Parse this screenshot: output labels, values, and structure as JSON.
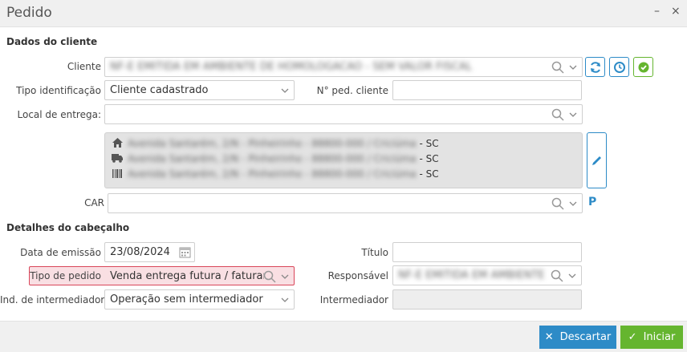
{
  "window": {
    "title": "Pedido",
    "minimize_glyph": "–",
    "close_glyph": "×"
  },
  "sections": {
    "client": "Dados do cliente",
    "header": "Detalhes do cabeçalho"
  },
  "client": {
    "cliente_label": "Cliente",
    "cliente_value": "NF-E EMITIDA EM AMBIENTE DE HOMOLOGACAO - SEM VALOR FISCAL",
    "tipo_label": "Tipo identificação",
    "tipo_value": "Cliente cadastrado",
    "nped_label": "N° ped. cliente",
    "nped_value": "",
    "local_label": "Local de entrega:",
    "local_value": "",
    "addresses": [
      {
        "icon": "home-icon",
        "blurred": "Avenida Santarém, 2/N - Pinheirinho - 88800-000 / Criciúma",
        "suffix": "- SC"
      },
      {
        "icon": "truck-icon",
        "blurred": "Avenida Santarém, 2/N - Pinheirinho - 88800-000 / Criciúma",
        "suffix": "- SC"
      },
      {
        "icon": "barcode-icon",
        "blurred": "Avenida Santarém, 2/N - Pinheirinho - 88800-000 / Criciúma",
        "suffix": "- SC"
      }
    ],
    "car_label": "CAR",
    "car_value": "",
    "p_badge": "P"
  },
  "header": {
    "emissao_label": "Data de emissão",
    "emissao_value": "23/08/2024",
    "titulo_label": "Título",
    "titulo_value": "",
    "tipo_pedido_label": "Tipo de pedido",
    "tipo_pedido_value": "Venda entrega futura / faturame",
    "responsavel_label": "Responsável",
    "responsavel_value": "NF-E EMITIDA EM AMBIENTE DE H",
    "ind_label": "Ind. de intermediador",
    "ind_value": "Operação sem intermediador",
    "intermediador_label": "Intermediador",
    "intermediador_value": ""
  },
  "footer": {
    "descartar_label": "Descartar",
    "iniciar_label": "Iniciar"
  },
  "colors": {
    "primary": "#2d8bc7",
    "success": "#65b52f",
    "highlight_border": "#d9465a",
    "highlight_bg": "#f9dfe3"
  }
}
